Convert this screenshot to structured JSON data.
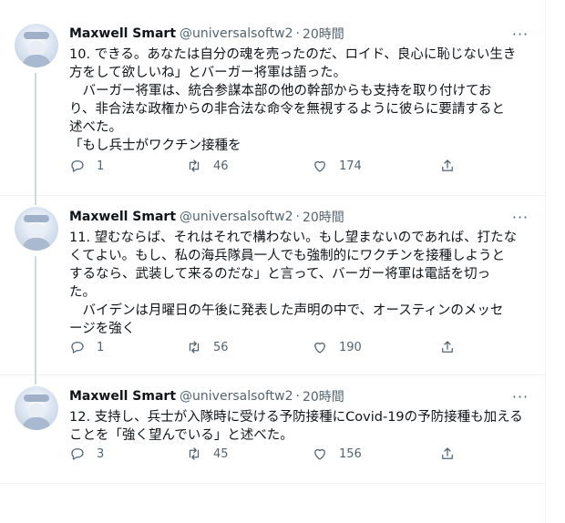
{
  "tweets": [
    {
      "name": "Maxwell Smart",
      "handle": "@universalsoftw2",
      "dot": "·",
      "time": "20時間",
      "text": "10. できる。あなたは自分の魂を売ったのだ、ロイド、良心に恥じない生き\n方をして欲しいね」とバーガー将軍は語った。\n　バーガー将軍は、統合参謀本部の他の幹部からも支持を取り付けてお\nり、非合法な政権からの非合法な命令を無視するように彼らに要請すると\n述べた。\n「もし兵士がワクチン接種を",
      "reply_count": "1",
      "retweet_count": "46",
      "like_count": "174"
    },
    {
      "name": "Maxwell Smart",
      "handle": "@universalsoftw2",
      "dot": "·",
      "time": "20時間",
      "text": "11. 望むならば、それはそれで構わない。もし望まないのであれば、打たな\nくてよい。もし、私の海兵隊員一人でも強制的にワクチンを接種しようと\nするなら、武装して来るのだな」と言って、バーガー将軍は電話を切っ\nた。\n　バイデンは月曜日の午後に発表した声明の中で、オースティンのメッセ\nージを強く",
      "reply_count": "1",
      "retweet_count": "56",
      "like_count": "190"
    },
    {
      "name": "Maxwell Smart",
      "handle": "@universalsoftw2",
      "dot": "·",
      "time": "20時間",
      "text": "12. 支持し、兵士が入隊時に受ける予防接種にCovid-19の予防接種も加える\nことを「強く望んでいる」と述べた。",
      "reply_count": "3",
      "retweet_count": "45",
      "like_count": "156"
    }
  ],
  "icons": {
    "more": "more-icon",
    "reply": "reply-icon",
    "retweet": "retweet-icon",
    "like": "like-icon",
    "share": "share-icon"
  },
  "more_glyph": "···"
}
